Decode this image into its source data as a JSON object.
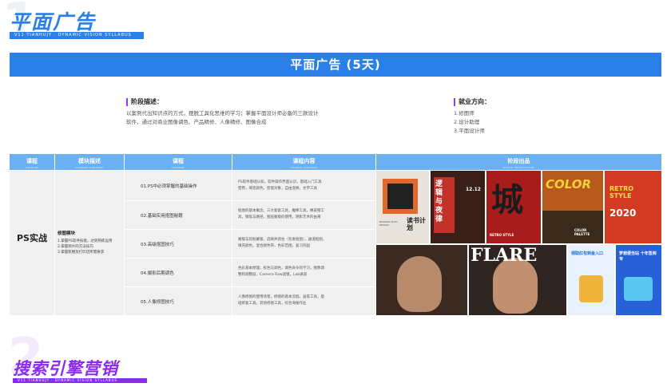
{
  "heading": {
    "number": "1",
    "title": "平面广告",
    "subtitle": "V11 TIANHUJY · DYNAMIC VISION SYLLABUS"
  },
  "banner": {
    "title": "平面广告 (5天)"
  },
  "stage_description": {
    "title": "阶段描述：",
    "lines": [
      "以案例代出知识点的方式，摆脱工具化思维的学习；掌握平面设计师必备的三款设计",
      "软件，通过对商业图像调色、产品精修、人像精修、图像合成"
    ]
  },
  "employment": {
    "title": "就业方向：",
    "items": [
      "1.修图师",
      "2.设计助理",
      "3.平面设计师"
    ]
  },
  "table": {
    "headers": [
      {
        "label": "课程",
        "sub": "COURSE"
      },
      {
        "label": "模块描述",
        "sub": "COURSE CONTENT"
      },
      {
        "label": "课程",
        "sub": "COURSE"
      },
      {
        "label": "课程内容",
        "sub": "COURSE CONTENT"
      },
      {
        "label": "阶段出品",
        "sub": "STAGE PRODUCTION"
      }
    ],
    "course": "PS实战",
    "module": {
      "title": "修图模块",
      "items": [
        "1.掌握PS软件技能，达到熟练运用",
        "2.掌握修片的方法技巧",
        "3.掌握影楼及打印店所需要求"
      ]
    },
    "rows": [
      {
        "name": "01.PS中必须掌握的基础操作",
        "desc": [
          "PS软件基础认知，软件操作界面认识，基础入门工具",
          "使用，填充颜色，智能对象，自由变换，文字工具"
        ]
      },
      {
        "name": "02.基础实用抠图秘籍",
        "desc": [
          "抠图的基本概念，三大套索工具，魔棒工具，橡皮擦工",
          "具，钢笔与路径，图层蒙版的使用，阴影艺术的由来"
        ]
      },
      {
        "name": "03.高级抠图技巧",
        "desc": [
          "蒙版与剪贴蒙版，选择并遮住（毛发抠图），通道抠图，",
          "填充颜色，混合颜色带，色彩范围，复习巩固"
        ]
      },
      {
        "name": "04.摄影后期调色",
        "desc": [
          "色彩基本原理，校色与调色，调色命令的学习，图像调",
          "整和调整层，Camera Raw滤镜，Lab通道"
        ]
      },
      {
        "name": "05.人像修图技巧",
        "desc": [
          "人像修图的使用场景，修图的基本流程，画笔工具，基",
          "础修复工具，其他修图工具，综合海报作业"
        ]
      }
    ]
  },
  "posters": {
    "p1": {
      "big": "读书计划",
      "small": "READING PLAN DESIGN"
    },
    "p2": {
      "big": "逻辑与夜律",
      "date": "12.12"
    },
    "p3": {
      "big": "城",
      "small": "RETRO STYLE"
    },
    "p4": {
      "big": "COLOR",
      "small": "COLOR PALETTE"
    },
    "p5": {
      "big": "RETRO STYLE",
      "year": "2020"
    },
    "p6": {
      "big": "FLARE"
    },
    "p7": {
      "big": "领取红包到金入口"
    },
    "p8": {
      "big": "梦想便当站 十年签到专"
    }
  },
  "colors": {
    "brand_blue": "#2a80e8",
    "header_blue": "#6ab0f2",
    "purple": "#8a2cf0"
  },
  "bottom_heading": {
    "number": "2",
    "title": "搜索引擎营销",
    "subtitle": "V11 TIANHUJY · DYNAMIC VISION SYLLABUS"
  }
}
